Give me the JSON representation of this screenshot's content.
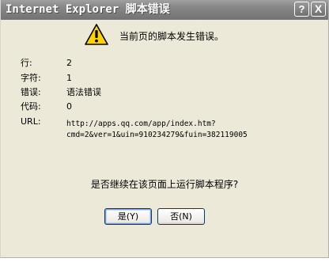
{
  "window": {
    "title": "Internet Explorer 脚本错误",
    "help_glyph": "?",
    "close_glyph": "X"
  },
  "dialog": {
    "icon": "warning-icon",
    "message": "当前页的脚本发生错误。",
    "details": [
      {
        "label": "行:",
        "value": "2"
      },
      {
        "label": "字符:",
        "value": "1"
      },
      {
        "label": "错误:",
        "value": "语法错误"
      },
      {
        "label": "代码:",
        "value": "0"
      }
    ],
    "url_label": "URL:",
    "url_line1": "http://apps.qq.com/app/index.htm?",
    "url_line2": "cmd=2&ver=1&uin=910234279&fuin=382119005",
    "question": "是否继续在该页面上运行脚本程序?",
    "yes_label": "是(Y)",
    "no_label": "否(N)"
  },
  "colors": {
    "titlebar": "#808080",
    "window_bg": "#ece9d8",
    "warning_yellow": "#ffd200"
  }
}
